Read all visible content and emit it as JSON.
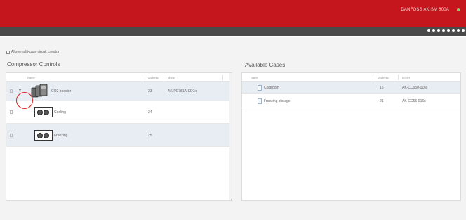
{
  "header": {
    "device_label": "DANFOSS AK-SM 800A",
    "status_color": "#8bd06a",
    "brand_color": "#c4161c"
  },
  "nav": {
    "page_dots": 8
  },
  "options": {
    "allow_multicase_label": "Allow multi-case circuit creation",
    "allow_multicase_checked": false
  },
  "compressor_controls": {
    "title": "Compressor Controls",
    "columns": {
      "name": "Name",
      "address": "Address",
      "model": "Model"
    },
    "rows": [
      {
        "name": "CO2 booster",
        "address": "23",
        "model": "AK-PC781A-SD7x",
        "selected": true,
        "icon": "booster-icon"
      },
      {
        "name": "Cooling",
        "address": "24",
        "model": "",
        "selected": false,
        "icon": "compressor-pack-icon"
      },
      {
        "name": "Freezing",
        "address": "25",
        "model": "",
        "selected": true,
        "icon": "compressor-pack-icon"
      }
    ]
  },
  "available_cases": {
    "title": "Available Cases",
    "columns": {
      "name": "Name",
      "address": "Address",
      "model": "Model"
    },
    "rows": [
      {
        "name": "Coldroom",
        "address": "15",
        "model": "AK-CC550-016x",
        "selected": true,
        "icon": "case-doc-icon"
      },
      {
        "name": "Freezing storage",
        "address": "21",
        "model": "AK-CC55-016x",
        "selected": false,
        "icon": "case-doc-icon"
      }
    ]
  }
}
